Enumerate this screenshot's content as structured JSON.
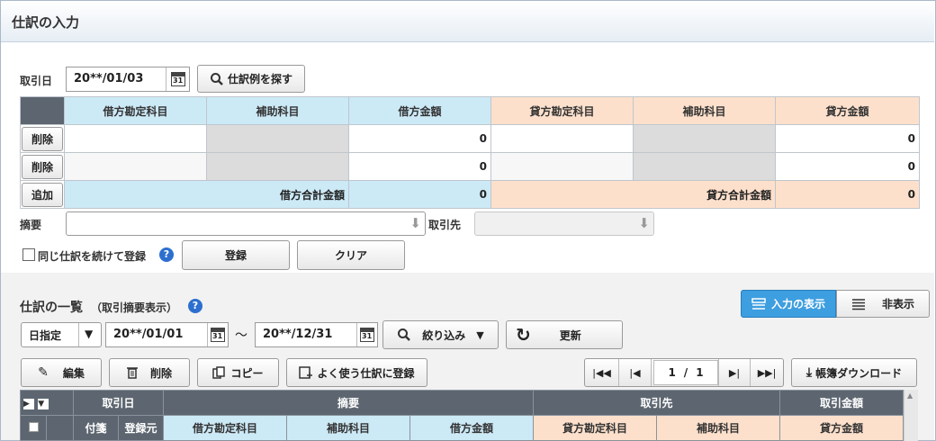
{
  "title": "仕訳の入力",
  "entry": {
    "date_label": "取引日",
    "date_value": "20**/01/03",
    "calendar_day": "31",
    "search_example_label": "仕訳例を探す",
    "headers": {
      "debit_account": "借方勘定科目",
      "debit_sub": "補助科目",
      "debit_amount": "借方金額",
      "credit_account": "貸方勘定科目",
      "credit_sub": "補助科目",
      "credit_amount": "貸方金額"
    },
    "rows": [
      {
        "action": "削除",
        "debit_amount": "0",
        "credit_amount": "0"
      },
      {
        "action": "削除",
        "debit_amount": "0",
        "credit_amount": "0"
      }
    ],
    "add_label": "追加",
    "debit_total_label": "借方合計金額",
    "debit_total": "0",
    "credit_total_label": "貸方合計金額",
    "credit_total": "0",
    "memo_label": "摘要",
    "partner_label": "取引先",
    "continue_label": "同じ仕訳を続けて登録",
    "register_label": "登録",
    "clear_label": "クリア"
  },
  "list": {
    "title": "仕訳の一覧",
    "subtitle": "（取引摘要表示）",
    "view_input_label": "入力の表示",
    "view_hide_label": "非表示",
    "date_mode": "日指定",
    "date_from": "20**/01/01",
    "date_to": "20**/12/31",
    "tilde": "〜",
    "filter_label": "絞り込み",
    "refresh_label": "更新",
    "edit_label": "編集",
    "delete_label": "削除",
    "copy_label": "コピー",
    "favorite_label": "よく使う仕訳に登録",
    "page_current": "1",
    "page_sep": "/",
    "page_total": "1",
    "download_label": "帳簿ダウンロード",
    "columns": {
      "date": "取引日",
      "memo": "摘要",
      "partner": "取引先",
      "amount": "取引金額",
      "tag": "付箋",
      "source": "登録元",
      "debit_account": "借方勘定科目",
      "debit_sub": "補助科目",
      "debit_amount": "借方金額",
      "credit_account": "貸方勘定科目",
      "credit_sub": "補助科目",
      "credit_amount": "貸方金額"
    }
  }
}
